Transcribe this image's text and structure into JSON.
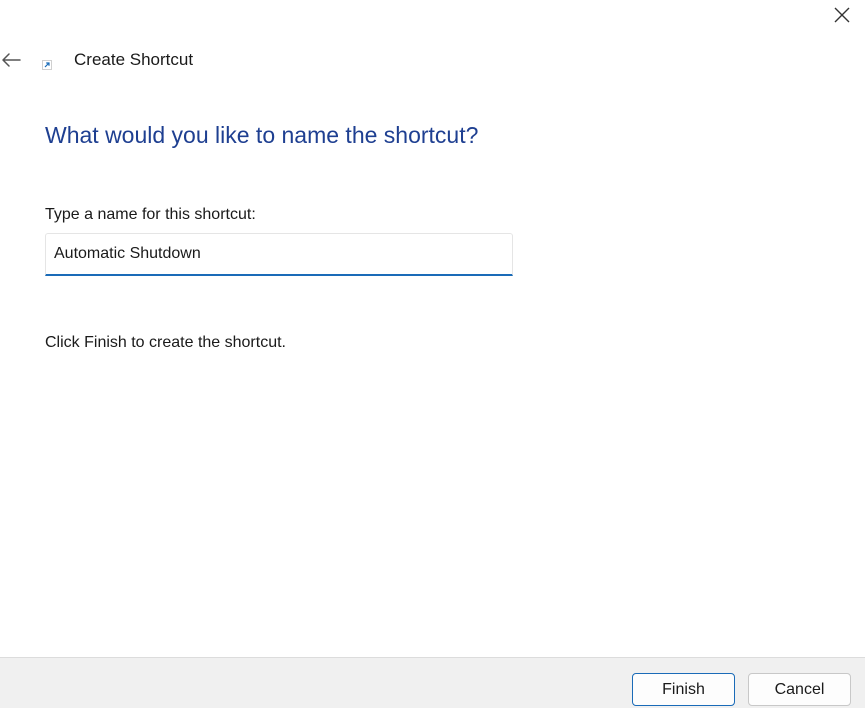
{
  "window": {
    "title": "Create Shortcut",
    "icons": {
      "back": "back-arrow-icon",
      "close": "close-icon",
      "title": "shortcut-icon"
    }
  },
  "main": {
    "heading": "What would you like to name the shortcut?",
    "field_label": "Type a name for this shortcut:",
    "name_value": "Automatic Shutdown",
    "finish_note": "Click Finish to create the shortcut."
  },
  "footer": {
    "finish_label": "Finish",
    "cancel_label": "Cancel"
  },
  "colors": {
    "heading": "#1e3f91",
    "accent": "#1a6bb8",
    "footer_bg": "#f0f0f0"
  }
}
